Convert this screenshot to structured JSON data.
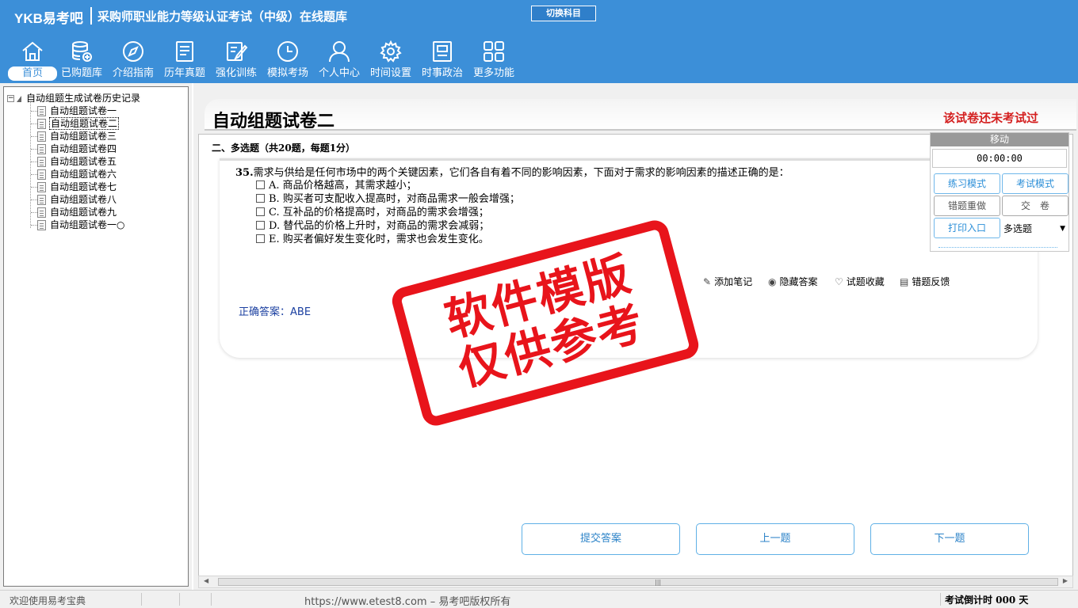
{
  "header": {
    "logo": "YKB易考吧",
    "title": "采购师职业能力等级认证考试（中级）在线题库",
    "switch_label": "切换科目"
  },
  "nav": [
    {
      "label": "首页",
      "icon": "home-icon"
    },
    {
      "label": "已购题库",
      "icon": "database-icon"
    },
    {
      "label": "介绍指南",
      "icon": "compass-icon"
    },
    {
      "label": "历年真题",
      "icon": "list-icon"
    },
    {
      "label": "强化训练",
      "icon": "edit-icon"
    },
    {
      "label": "模拟考场",
      "icon": "clock-icon"
    },
    {
      "label": "个人中心",
      "icon": "user-icon"
    },
    {
      "label": "时间设置",
      "icon": "gear-icon"
    },
    {
      "label": "时事政治",
      "icon": "news-icon"
    },
    {
      "label": "更多功能",
      "icon": "grid-icon"
    }
  ],
  "tree": {
    "root": "自动组题生成试卷历史记录",
    "items": [
      "自动组题试卷一",
      "自动组题试卷二",
      "自动组题试卷三",
      "自动组题试卷四",
      "自动组题试卷五",
      "自动组题试卷六",
      "自动组题试卷七",
      "自动组题试卷八",
      "自动组题试卷九",
      "自动组题试卷一○"
    ],
    "selected_index": 1
  },
  "paper": {
    "title": "自动组题试卷二",
    "status": "该试卷还未考试过"
  },
  "section": {
    "title": "二、多选题（共20题，每题1分）"
  },
  "question": {
    "number": "35.",
    "text": "需求与供给是任何市场中的两个关键因素，它们各自有着不同的影响因素，下面对于需求的影响因素的描述正确的是：",
    "options": [
      "A. 商品价格越高，其需求越小；",
      "B. 购买者可支配收入提高时，对商品需求一般会增强；",
      "C. 互补品的价格提高时，对商品的需求会增强；",
      "D. 替代品的价格上升时，对商品的需求会减弱；",
      "E. 购买者偏好发生变化时，需求也会发生变化。"
    ],
    "answer_label": "正确答案：",
    "answer_value": "ABE"
  },
  "tools": {
    "add_note": "添加笔记",
    "hide_answer": "隐藏答案",
    "favorite": "试题收藏",
    "feedback": "错题反馈"
  },
  "buttons": {
    "submit": "提交答案",
    "prev": "上一题",
    "next": "下一题"
  },
  "timer": {
    "header": "移动",
    "value": "00:00:00",
    "practice_mode": "练习模式",
    "exam_mode": "考试模式",
    "redo_wrong": "错题重做",
    "hand_in": "交　卷",
    "print": "打印入口",
    "question_type": "多选题"
  },
  "watermark": {
    "line1": "软件模版",
    "line2": "仅供参考"
  },
  "statusbar": {
    "welcome": "欢迎使用易考宝典",
    "url": "https://www.etest8.com – 易考吧版权所有",
    "countdown": "考试倒计时 000 天"
  },
  "colors": {
    "header_bg": "#3c8fd8",
    "status_red": "#d42020",
    "stamp_red": "#e8141b",
    "answer_blue": "#1a3fa0",
    "button_blue": "#2c83c8"
  }
}
